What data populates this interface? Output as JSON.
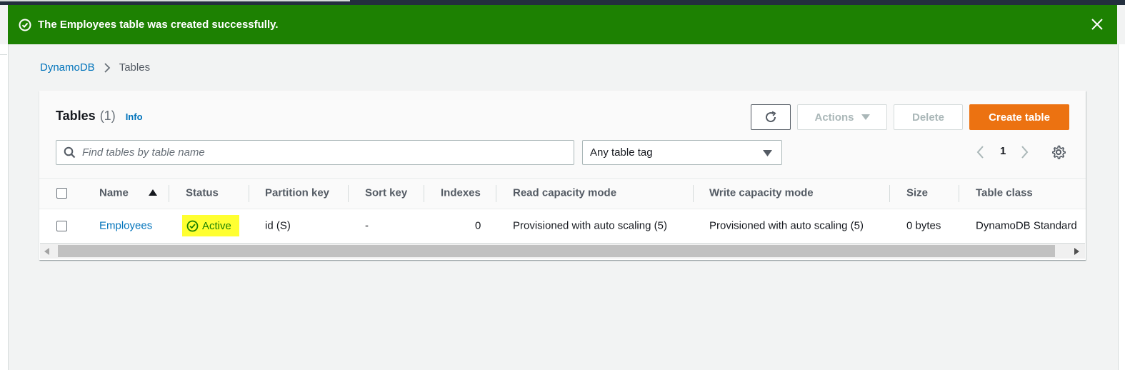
{
  "flash": {
    "message": "The Employees table was created successfully.",
    "icon": "check-circle-icon",
    "close_icon": "close-icon",
    "color": "#1d8102"
  },
  "breadcrumb": {
    "root": "DynamoDB",
    "current": "Tables"
  },
  "panel": {
    "title": "Tables",
    "count": "(1)",
    "info_label": "Info"
  },
  "toolbar": {
    "refresh_icon": "refresh-icon",
    "actions_label": "Actions",
    "delete_label": "Delete",
    "create_label": "Create table",
    "create_color": "#ec7211"
  },
  "search": {
    "placeholder": "Find tables by table name",
    "value": ""
  },
  "tag_filter": {
    "selected": "Any table tag"
  },
  "pagination": {
    "page": "1"
  },
  "table": {
    "columns": [
      "Name",
      "Status",
      "Partition key",
      "Sort key",
      "Indexes",
      "Read capacity mode",
      "Write capacity mode",
      "Size",
      "Table class"
    ],
    "sort": {
      "column": "Name",
      "direction": "ascending"
    },
    "rows": [
      {
        "name": "Employees",
        "status": "Active",
        "partition_key": "id (S)",
        "sort_key": "-",
        "indexes": "0",
        "read_capacity_mode": "Provisioned with auto scaling (5)",
        "write_capacity_mode": "Provisioned with auto scaling (5)",
        "size": "0 bytes",
        "table_class": "DynamoDB Standard"
      }
    ]
  },
  "colors": {
    "link": "#0073bb",
    "status_highlight": "#ffff31"
  }
}
